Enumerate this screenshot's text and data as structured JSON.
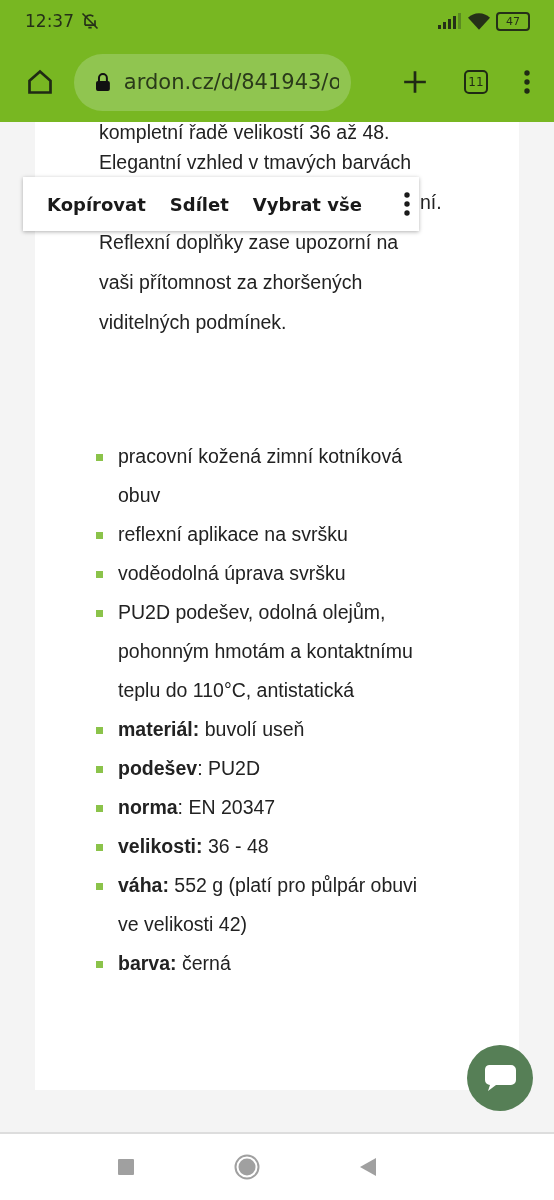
{
  "status_bar": {
    "time": "12:37",
    "battery": "47"
  },
  "browser_toolbar": {
    "url": "ardon.cz/d/841943/o",
    "tab_count": "11"
  },
  "paragraph_lines": [
    "kompletní řadě velikostí 36 až 48.",
    "Elegantní vzhled v tmavých barvách",
    "ní.",
    "Reflexní doplňky zase upozorní na",
    "vaši přítomnost za zhoršených",
    "viditelných podmínek."
  ],
  "selection_menu": {
    "items": [
      "Kopírovat",
      "Sdílet",
      "Vybrat vše"
    ]
  },
  "features": [
    "pracovní kožená zimní kotníková obuv",
    "reflexní aplikace na svršku",
    "voděodolná úprava svršku",
    "PU2D podešev, odolná olejům, pohonným hmotám a kontaktnímu teplu do 110°C, antistatická",
    "**materiál:** buvolí useň",
    "**podešev**: PU2D",
    "**norma**: EN 20347",
    "**velikosti:** 36 - 48",
    "**váha:** 552 g (platí pro půlpár obuvi ve velikosti 42)",
    "**barva:** černá"
  ]
}
